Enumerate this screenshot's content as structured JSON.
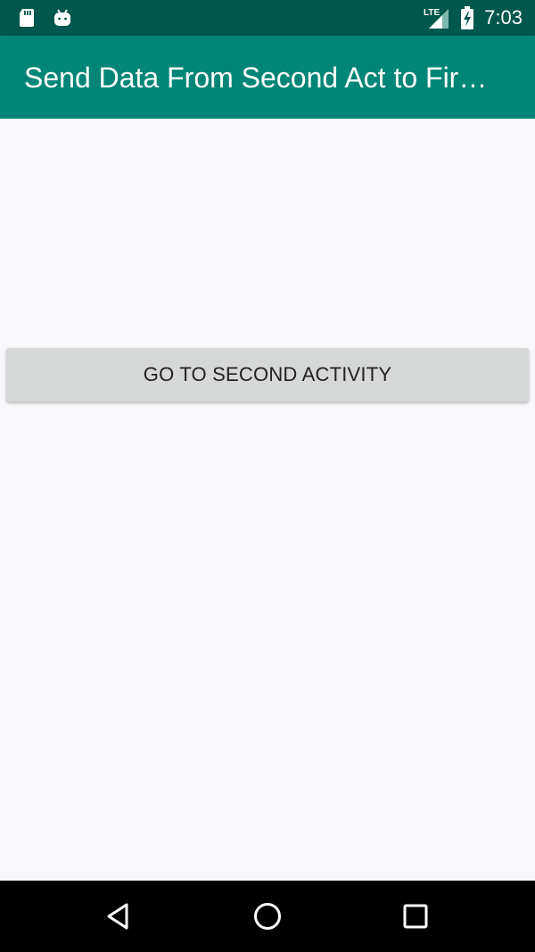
{
  "status_bar": {
    "time": "7:03",
    "network_label": "LTE",
    "icons": [
      "sd-card-icon",
      "android-icon",
      "lte-signal-icon",
      "battery-charging-icon"
    ]
  },
  "app_bar": {
    "title": "Send Data From Second Act to Fir…"
  },
  "main": {
    "button_label": "GO TO SECOND ACTIVITY"
  },
  "nav_bar": {
    "icons": [
      "back-icon",
      "home-icon",
      "recents-icon"
    ]
  },
  "colors": {
    "status_bar": "#00574d",
    "app_bar": "#008577",
    "background": "#f8f7fa",
    "button": "#d6d7d7",
    "nav_bar": "#000000"
  }
}
